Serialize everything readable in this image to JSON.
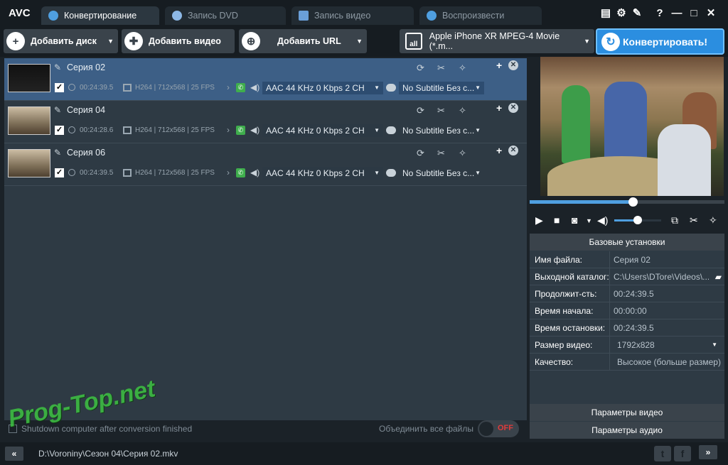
{
  "app": {
    "logo": "AVC"
  },
  "tabs": [
    {
      "label": "Конвертирование",
      "active": true
    },
    {
      "label": "Запись DVD",
      "active": false
    },
    {
      "label": "Запись видео",
      "active": false
    },
    {
      "label": "Воспроизвести",
      "active": false
    }
  ],
  "window_controls": {
    "help": "?"
  },
  "toolbar": {
    "add_disc": "Добавить диск",
    "add_video": "Добавить видео",
    "add_url": "Добавить URL",
    "profile_icon_text": "all",
    "profile": "Apple iPhone XR MPEG-4 Movie (*.m...",
    "convert": "Конвертировать!"
  },
  "items": [
    {
      "name": "Серия 02",
      "duration": "00:24:39.5",
      "video": "H264 | 712x568 | 25 FPS",
      "audio": "AAC 44 KHz 0 Kbps 2 CH",
      "subtitle": "No Subtitle Без с...",
      "selected": true
    },
    {
      "name": "Серия 04",
      "duration": "00:24:28.6",
      "video": "H264 | 712x568 | 25 FPS",
      "audio": "AAC 44 KHz 0 Kbps 2 CH",
      "subtitle": "No Subtitle Без с...",
      "selected": false
    },
    {
      "name": "Серия 06",
      "duration": "00:24:39.5",
      "video": "H264 | 712x568 | 25 FPS",
      "audio": "AAC 44 KHz 0 Kbps 2 CH",
      "subtitle": "No Subtitle Без с...",
      "selected": false
    }
  ],
  "list_footer": {
    "shutdown": "Shutdown computer after conversion finished",
    "merge": "Объединить все файлы",
    "toggle": "OFF"
  },
  "status": {
    "path": "D:\\Voroniny\\Сезон 04\\Серия 02.mkv"
  },
  "player": {
    "seek_progress": 0.53,
    "volume": 0.5
  },
  "props": {
    "title": "Базовые установки",
    "rows": [
      {
        "label": "Имя файла:",
        "value": "Серия 02"
      },
      {
        "label": "Выходной каталог:",
        "value": "C:\\Users\\DTore\\Videos\\..."
      },
      {
        "label": "Продолжит-сть:",
        "value": "00:24:39.5"
      },
      {
        "label": "Время начала:",
        "value": "00:00:00"
      },
      {
        "label": "Время остановки:",
        "value": "00:24:39.5"
      },
      {
        "label": "Размер видео:",
        "value": "1792x828"
      },
      {
        "label": "Качество:",
        "value": "Высокое (больше размер)"
      }
    ],
    "video_params": "Параметры видео",
    "audio_params": "Параметры аудио"
  },
  "watermark": "Prog-Top.net"
}
